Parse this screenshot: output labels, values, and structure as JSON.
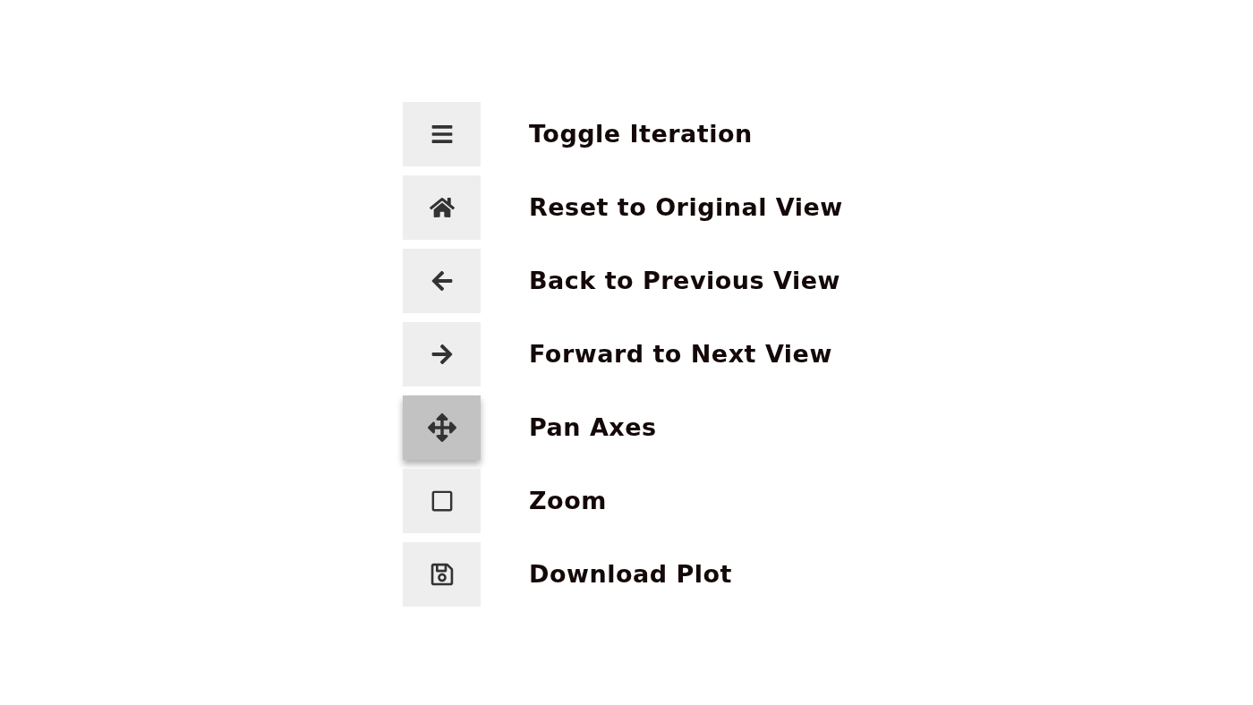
{
  "toolbar": {
    "tools": [
      {
        "label": "Toggle Iteration",
        "selected": false
      },
      {
        "label": "Reset to Original View",
        "selected": false
      },
      {
        "label": "Back to Previous View",
        "selected": false
      },
      {
        "label": "Forward to Next View",
        "selected": false
      },
      {
        "label": "Pan Axes",
        "selected": true
      },
      {
        "label": "Zoom",
        "selected": false
      },
      {
        "label": "Download Plot",
        "selected": false
      }
    ]
  }
}
